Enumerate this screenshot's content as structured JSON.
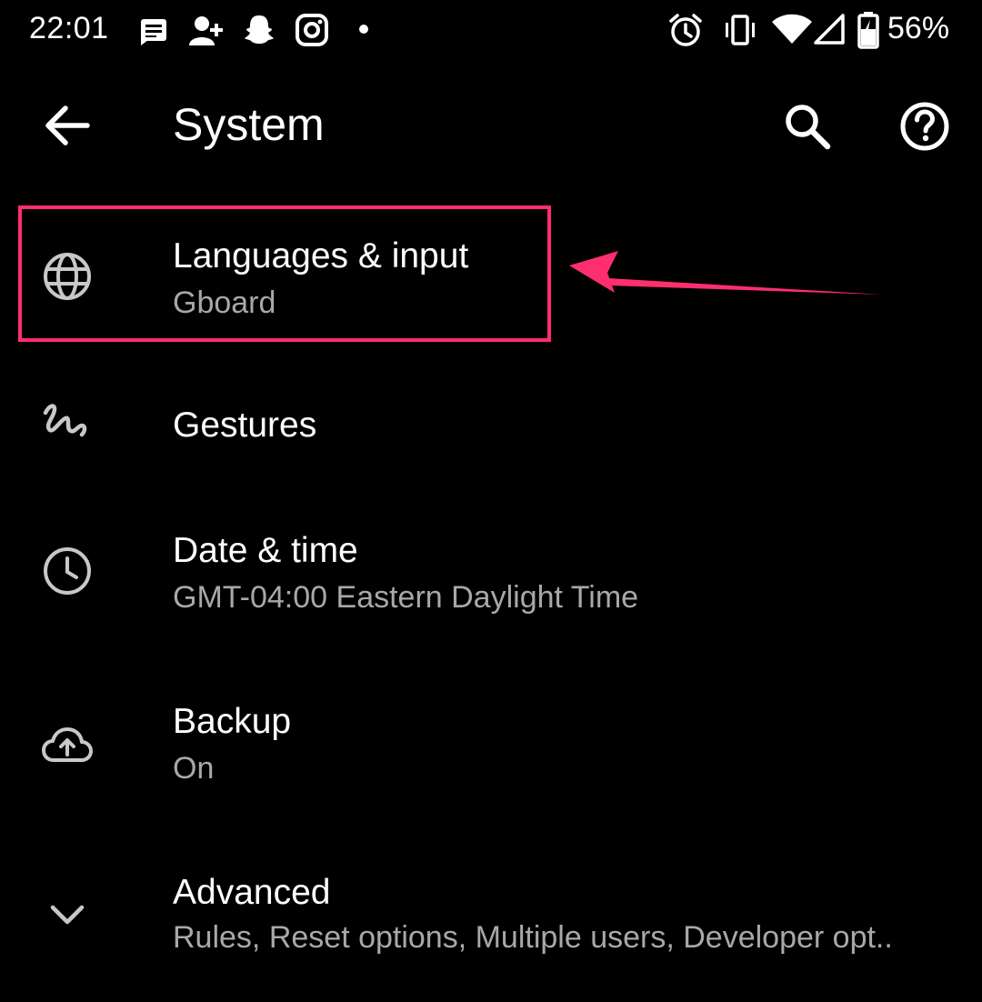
{
  "status_bar": {
    "time": "22:01",
    "notification_icons": [
      "messages-icon",
      "add-contact-icon",
      "snapchat-icon",
      "instagram-icon",
      "dot-icon"
    ],
    "system_icons": [
      "alarm-icon",
      "vibrate-icon",
      "wifi-icon",
      "signal-icon",
      "battery-charging-icon"
    ],
    "battery_percent": "56%"
  },
  "app_bar": {
    "title": "System",
    "back_icon": "back-arrow-icon",
    "search_icon": "search-icon",
    "help_icon": "help-icon"
  },
  "items": [
    {
      "title": "Languages & input",
      "subtitle": "Gboard",
      "icon": "globe-icon"
    },
    {
      "title": "Gestures",
      "subtitle": "",
      "icon": "gesture-icon"
    },
    {
      "title": "Date & time",
      "subtitle": "GMT-04:00 Eastern Daylight Time",
      "icon": "clock-icon"
    },
    {
      "title": "Backup",
      "subtitle": "On",
      "icon": "cloud-upload-icon"
    },
    {
      "title": "Advanced",
      "subtitle": "Rules, Reset options, Multiple users, Developer opt..",
      "icon": "chevron-down-icon"
    }
  ],
  "annotation": {
    "highlight_color": "#ff2e6e",
    "target": "Languages & input"
  }
}
